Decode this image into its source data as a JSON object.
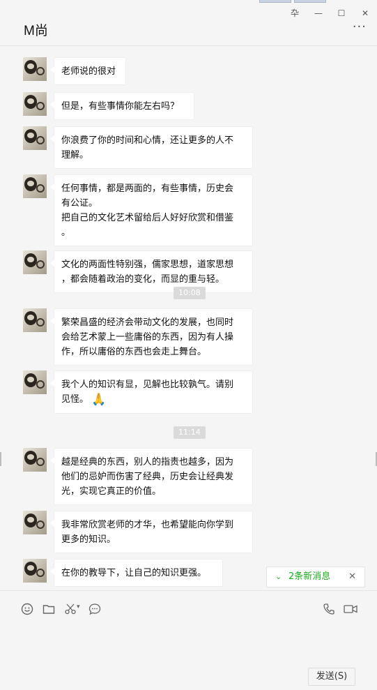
{
  "window": {
    "pin_label": "卆",
    "minimize_label": "—",
    "maximize_label": "☐",
    "close_label": "✕"
  },
  "chat": {
    "title": "M尚",
    "more_label": "···"
  },
  "messages": [
    {
      "lines": [
        "老师说的很对"
      ]
    },
    {
      "lines": [
        "但是，有些事情你能左右吗？"
      ]
    },
    {
      "lines": [
        "你浪费了你的时间和心情，还让更多的人不",
        "理解。"
      ]
    },
    {
      "lines": [
        "任何事情，都是两面的，有些事情，历史会",
        "有公证。",
        "把自己的文化艺术留给后人好好欣赏和借鉴",
        "。"
      ]
    },
    {
      "lines": [
        "文化的两面性特别强，儒家思想，道家思想",
        "，都会随着政治的变化，而显的重与轻。"
      ]
    },
    {
      "lines": [
        "繁荣昌盛的经济会带动文化的发展，也同时",
        "会给艺术蒙上一些庸俗的东西，因为有人操",
        "作，所以庸俗的东西也会走上舞台。"
      ]
    },
    {
      "lines": [
        "我个人的知识有显，见解也比较孰气。请别",
        "见怪。"
      ],
      "emoji": "🙏"
    },
    {
      "lines": [
        "越是经典的东西，别人的指责也越多，因为",
        "他们的忌妒而伤害了经典，历史会让经典发",
        "光，实现它真正的价值。"
      ]
    },
    {
      "lines": [
        "我非常欣赏老师的才华，也希望能向你学到",
        "更多的知识。"
      ]
    },
    {
      "lines": [
        "在你的教导下，让自己的知识更强。"
      ]
    }
  ],
  "timestamps": [
    "10:08",
    "11:14"
  ],
  "new_messages": {
    "label": "2条新消息",
    "chevron": "⌄",
    "close": "✕",
    "accent": "#1aad19"
  },
  "toolbar": {
    "icons": [
      "emoji-icon",
      "folder-icon",
      "scissors-icon",
      "chat-bubble-icon",
      "phone-icon",
      "video-icon"
    ],
    "scissors_caret": "▾"
  },
  "send_label": "发送(S)"
}
